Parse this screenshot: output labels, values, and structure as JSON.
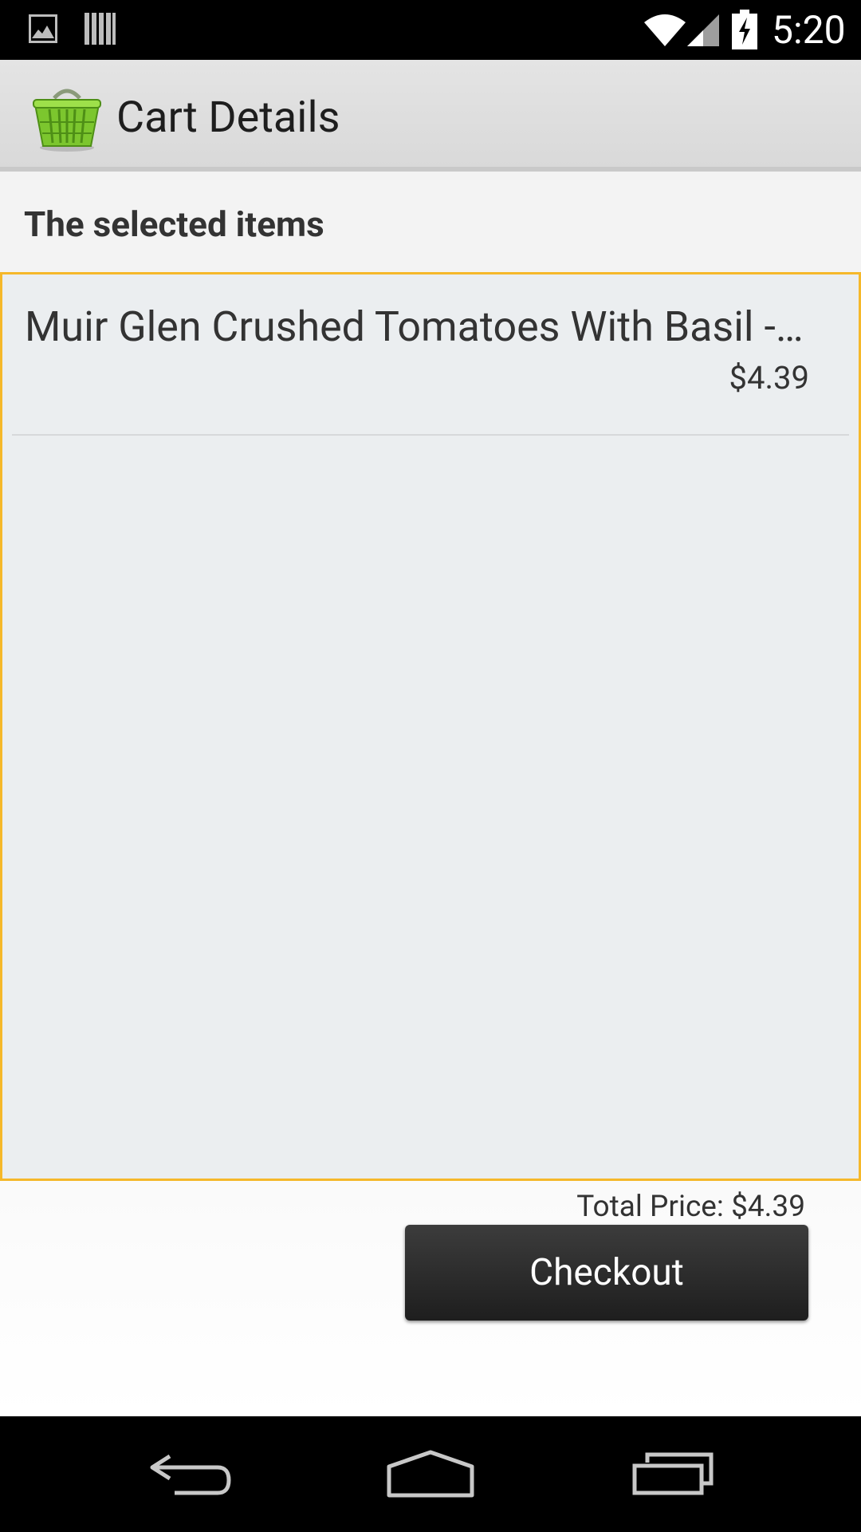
{
  "status_bar": {
    "time": "5:20",
    "icons": [
      "image-notification-icon",
      "barcode-notification-icon",
      "wifi-icon",
      "signal-icon",
      "battery-charging-icon"
    ]
  },
  "action_bar": {
    "title": "Cart Details",
    "icon": "shopping-basket-icon"
  },
  "content": {
    "section_label": "The selected items",
    "items": [
      {
        "name": "Muir Glen Crushed Tomatoes With Basil -…",
        "price": "$4.39"
      }
    ],
    "total_price": "Total Price: $4.39",
    "checkout_label": "Checkout"
  },
  "colors": {
    "accent_border": "#f5b82a",
    "list_background": "#ebeef0",
    "button_dark": "#2a2a2a",
    "basket_green": "#7cc62e"
  },
  "nav_bar": {
    "buttons": [
      "back-icon",
      "home-icon",
      "recents-icon"
    ]
  }
}
